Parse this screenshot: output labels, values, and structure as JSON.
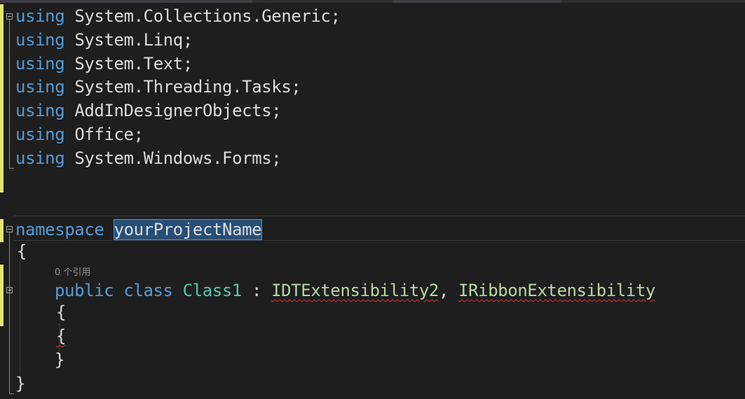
{
  "editor": {
    "usings": [
      {
        "kw": "using",
        "ns": "System.Collections.Generic;"
      },
      {
        "kw": "using",
        "ns": "System.Linq;"
      },
      {
        "kw": "using",
        "ns": "System.Text;"
      },
      {
        "kw": "using",
        "ns": "System.Threading.Tasks;"
      },
      {
        "kw": "using",
        "ns": "AddInDesignerObjects;"
      },
      {
        "kw": "using",
        "ns": "Office;"
      },
      {
        "kw": "using",
        "ns": "System.Windows.Forms;"
      }
    ],
    "namespace_kw": "namespace",
    "namespace_name": "yourProjectName",
    "open_brace": "{",
    "codelens": "0 个引用",
    "class_public_kw": "public",
    "class_kw": "class",
    "class_name": "Class1",
    "class_colon": " : ",
    "interface1": "IDTExtensibility2",
    "comma": ", ",
    "interface2": "IRibbonExtensibility",
    "class_open_brace": "{",
    "inner_brace": "{",
    "class_close_brace": "}",
    "ns_close_brace": "}"
  },
  "colors": {
    "background": "#1e1e1e",
    "keyword": "#569cd6",
    "type": "#4ec9b0",
    "interface": "#b8d7a3",
    "text": "#dcdcdc",
    "change_marker": "#e5e56e",
    "selection": "#264f78"
  }
}
